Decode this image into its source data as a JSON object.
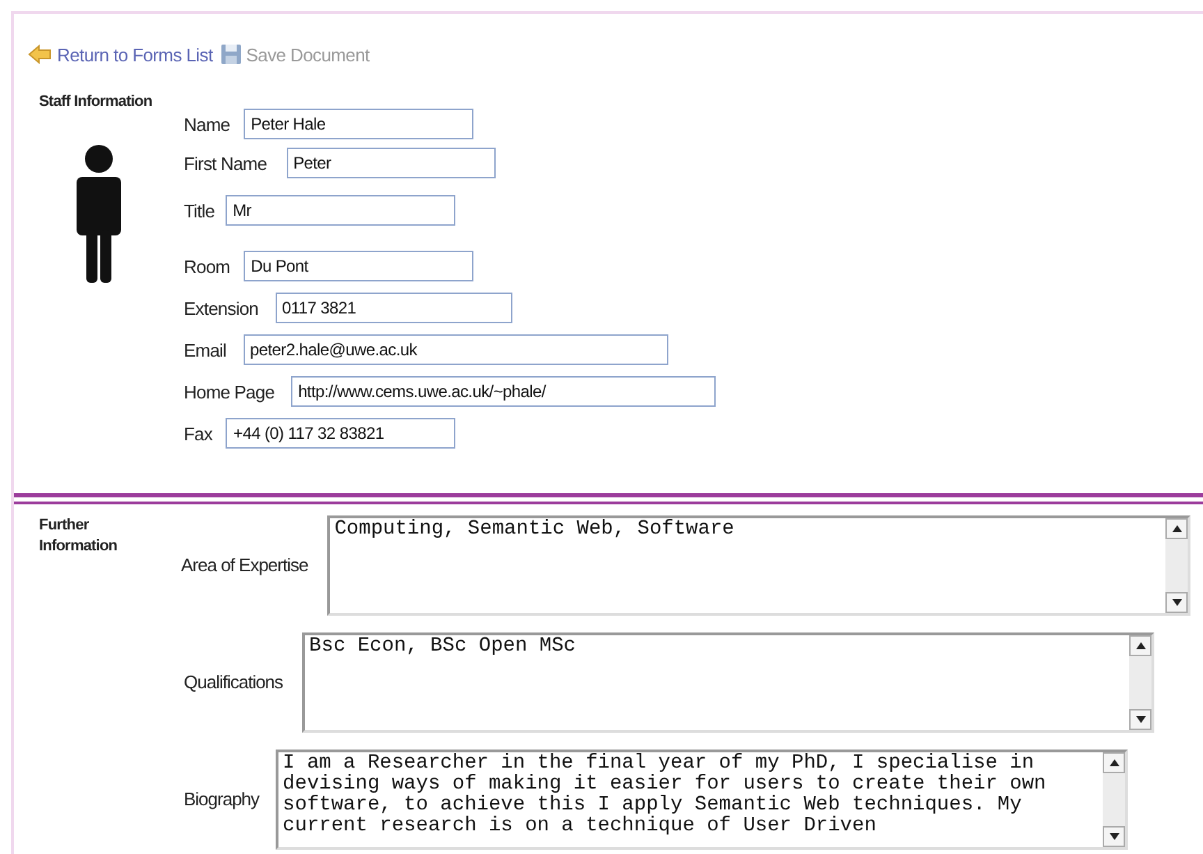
{
  "toolbar": {
    "return_link": "Return to Forms List",
    "save_button": {
      "label": "Save Document",
      "disabled": true
    }
  },
  "staff_section": {
    "title": "Staff Information",
    "fields": [
      {
        "label": "Name",
        "value": "Peter Hale"
      },
      {
        "label": "First Name",
        "value": "Peter"
      },
      {
        "label": "Title",
        "value": "Mr"
      },
      {
        "label": "Room",
        "value": "Du Pont"
      },
      {
        "label": "Extension",
        "value": "0117 3821"
      },
      {
        "label": "Email",
        "value": "peter2.hale@uwe.ac.uk"
      },
      {
        "label": "Home Page",
        "value": "http://www.cems.uwe.ac.uk/~phale/"
      },
      {
        "label": "Fax",
        "value": "+44 (0) 117 32 83821"
      }
    ]
  },
  "further_section": {
    "title": "Further Information",
    "fields": [
      {
        "label": "Area of Expertise",
        "value": "Computing, Semantic Web, Software"
      },
      {
        "label": "Qualifications",
        "value": "Bsc Econ, BSc Open MSc"
      },
      {
        "label": "Biography",
        "value": "I am a Researcher in the final year of my PhD, I specialise in devising ways of making it easier for users to create their own software, to achieve this I apply Semantic Web techniques. My current research is on a technique of User Driven"
      }
    ]
  }
}
